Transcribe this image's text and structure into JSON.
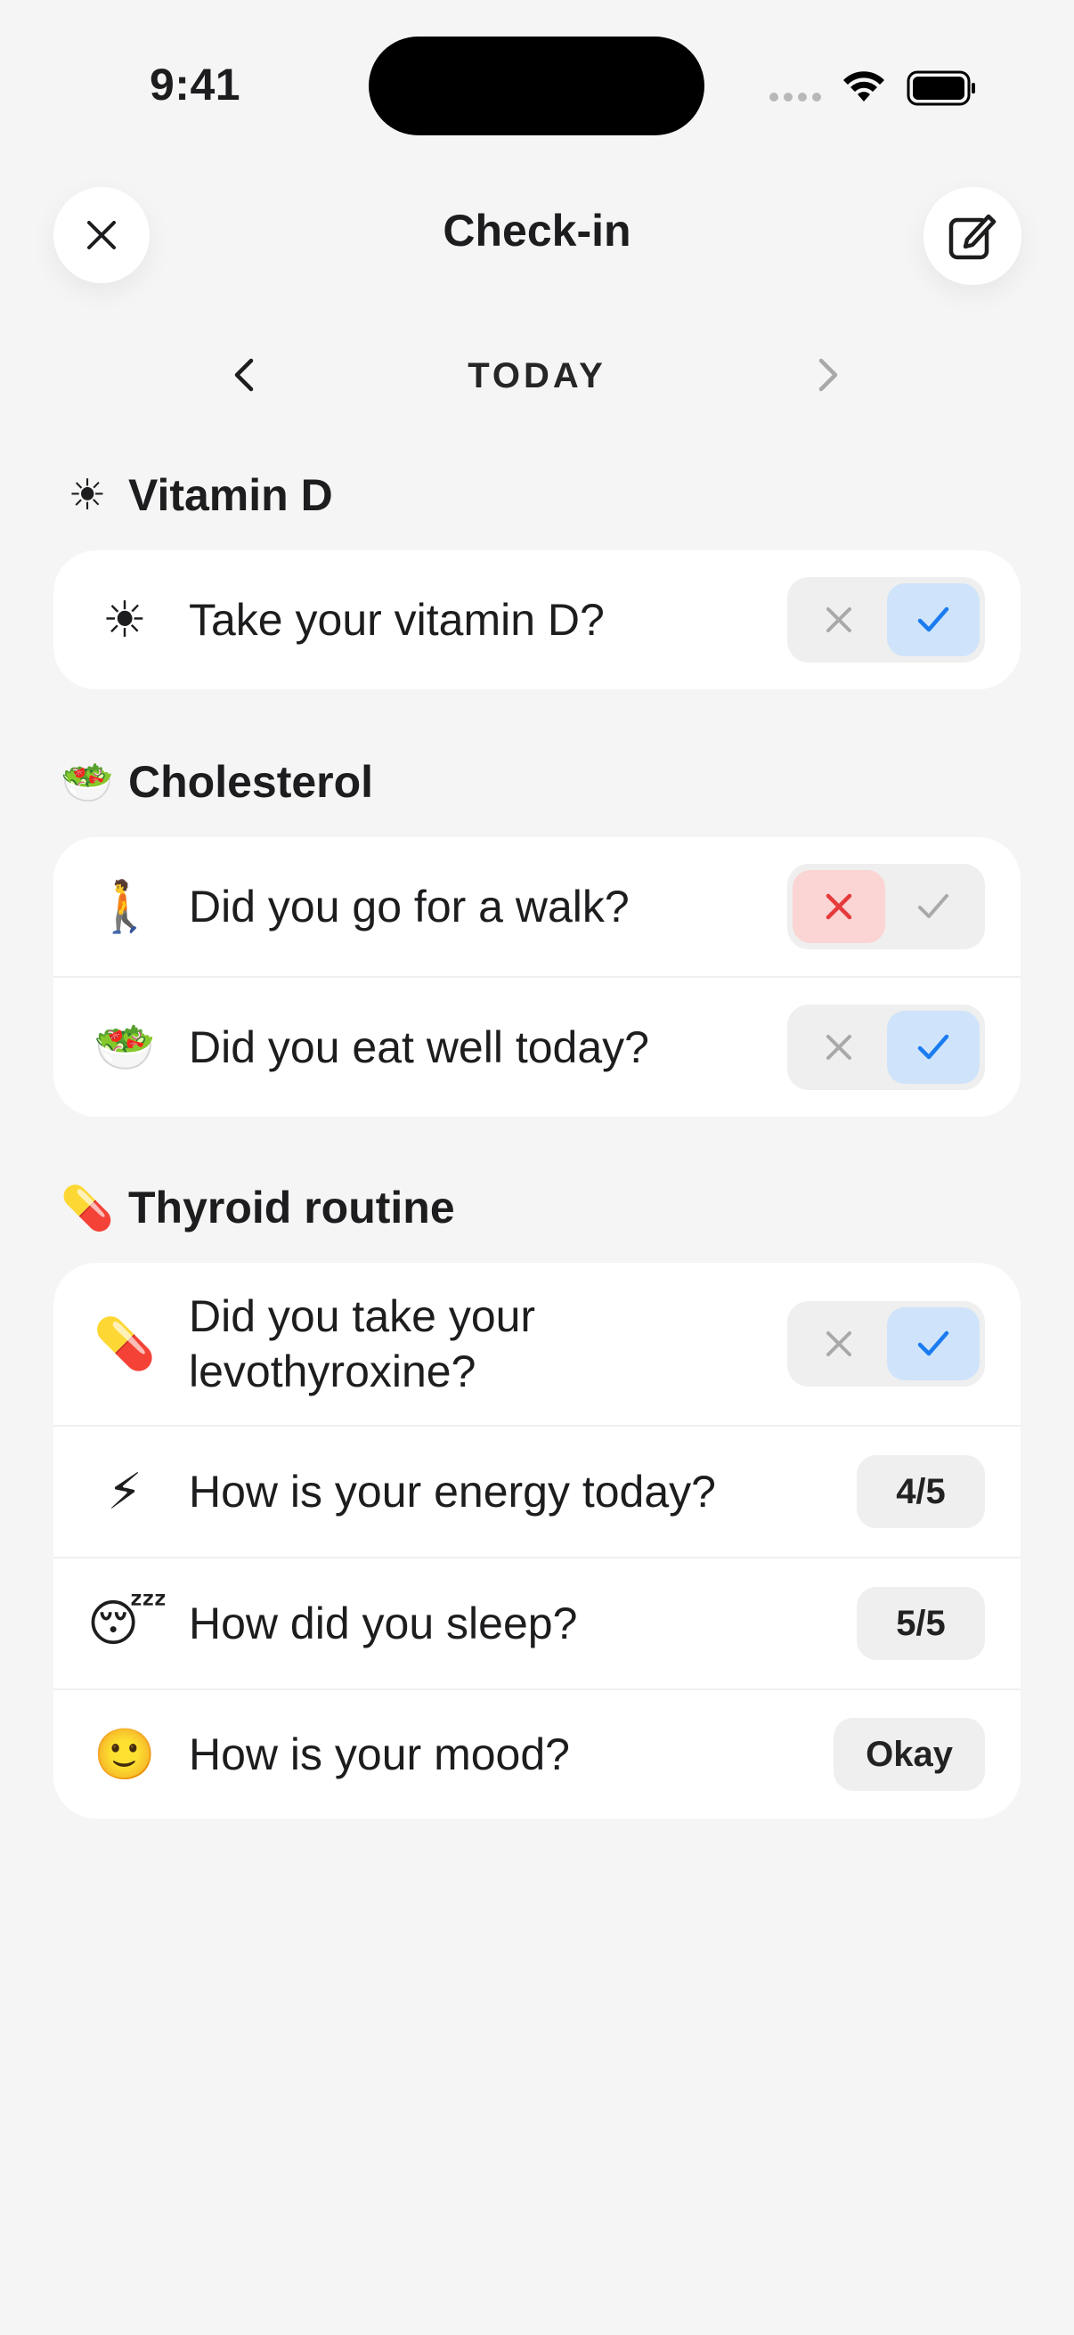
{
  "status_bar": {
    "time": "9:41"
  },
  "header": {
    "title": "Check-in"
  },
  "date_nav": {
    "label": "TODAY"
  },
  "sections": [
    {
      "emoji": "☀",
      "title": "Vitamin D",
      "rows": [
        {
          "emoji": "☀",
          "text": "Take your vitamin D?",
          "control": "toggle",
          "value": "yes"
        }
      ]
    },
    {
      "emoji": "🥗",
      "title": "Cholesterol",
      "rows": [
        {
          "emoji": "🚶",
          "text": "Did you go for a walk?",
          "control": "toggle",
          "value": "no"
        },
        {
          "emoji": "🥗",
          "text": "Did you eat well today?",
          "control": "toggle",
          "value": "yes"
        }
      ]
    },
    {
      "emoji": "💊",
      "title": "Thyroid routine",
      "rows": [
        {
          "emoji": "💊",
          "text": "Did you take your levothyroxine?",
          "control": "toggle",
          "value": "yes"
        },
        {
          "emoji": "⚡",
          "text": "How is your energy today?",
          "control": "pill",
          "value": "4/5"
        },
        {
          "emoji": "😴",
          "text": "How did you sleep?",
          "control": "pill",
          "value": "5/5"
        },
        {
          "emoji": "🙂",
          "text": "How is your mood?",
          "control": "pill",
          "value": "Okay"
        }
      ]
    }
  ],
  "colors": {
    "yes_accent": "#1a7cf0",
    "yes_bg": "#cfe4fa",
    "no_accent": "#e63b3b",
    "no_bg": "#fbd4d4",
    "muted": "#a9a9a9"
  }
}
